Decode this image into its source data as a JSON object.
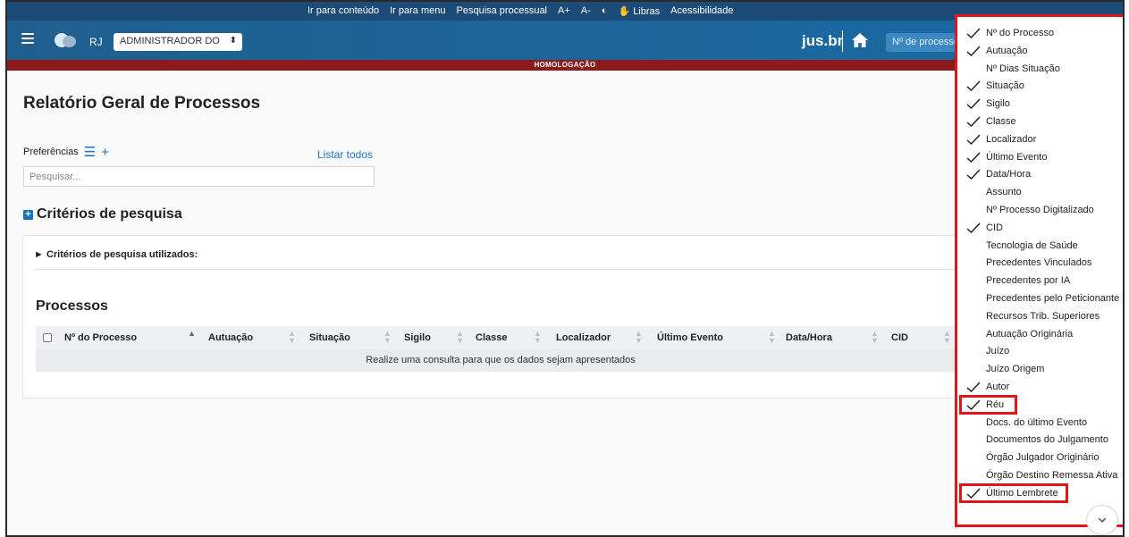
{
  "access_bar": {
    "links": [
      "Ir para conteúdo",
      "Ir para menu",
      "Pesquisa processual",
      "A+",
      "A-",
      "◐",
      "✋ Libras",
      "Acessibilidade"
    ]
  },
  "header": {
    "state": "RJ",
    "role": "ADMINISTRADOR DO",
    "brand": "jus.br",
    "search_placeholder": "Nº de processo"
  },
  "environment": "HOMOLOGAÇÃO",
  "page": {
    "title": "Relatório Geral de Processos",
    "preferences_label": "Preferências",
    "list_all": "Listar todos",
    "search_placeholder": "Pesquisar...",
    "criteria_title": "Critérios de pesquisa",
    "criteria_used": "► Critérios de pesquisa utilizados:",
    "processes_title": "Processos",
    "columns": [
      "Nº do Processo",
      "Autuação",
      "Situação",
      "Sigilo",
      "Classe",
      "Localizador",
      "Último Evento",
      "Data/Hora",
      "CID"
    ],
    "empty_message": "Realize uma consulta para que os dados sejam apresentados"
  },
  "column_menu": {
    "items": [
      {
        "label": "Nº do Processo",
        "checked": true
      },
      {
        "label": "Autuação",
        "checked": true
      },
      {
        "label": "Nº Dias Situação",
        "checked": false
      },
      {
        "label": "Situação",
        "checked": true
      },
      {
        "label": "Sigilo",
        "checked": true
      },
      {
        "label": "Classe",
        "checked": true
      },
      {
        "label": "Localizador",
        "checked": true
      },
      {
        "label": "Último Evento",
        "checked": true
      },
      {
        "label": "Data/Hora",
        "checked": true
      },
      {
        "label": "Assunto",
        "checked": false
      },
      {
        "label": "Nº Processo Digitalizado",
        "checked": false
      },
      {
        "label": "CID",
        "checked": true
      },
      {
        "label": "Tecnologia de Saúde",
        "checked": false
      },
      {
        "label": "Precedentes Vinculados",
        "checked": false
      },
      {
        "label": "Precedentes por IA",
        "checked": false
      },
      {
        "label": "Precedentes pelo Peticionante",
        "checked": false
      },
      {
        "label": "Recursos Trib. Superiores",
        "checked": false
      },
      {
        "label": "Autuação Originária",
        "checked": false
      },
      {
        "label": "Juízo",
        "checked": false
      },
      {
        "label": "Juízo Origem",
        "checked": false
      },
      {
        "label": "Autor",
        "checked": true
      },
      {
        "label": "Réu",
        "checked": true,
        "highlighted": true
      },
      {
        "label": "Docs. do último Evento",
        "checked": false
      },
      {
        "label": "Documentos do Julgamento",
        "checked": false
      },
      {
        "label": "Órgão Julgador Originário",
        "checked": false
      },
      {
        "label": "Órgão Destino Remessa Ativa",
        "checked": false
      },
      {
        "label": "Último Lembrete",
        "checked": true,
        "highlighted": true
      }
    ]
  },
  "colors": {
    "access_bar": "#1b4b76",
    "header": "#1a6aa4",
    "environment_bar": "#8e1b1b",
    "link": "#1a73c2",
    "highlight": "#e0161b"
  }
}
